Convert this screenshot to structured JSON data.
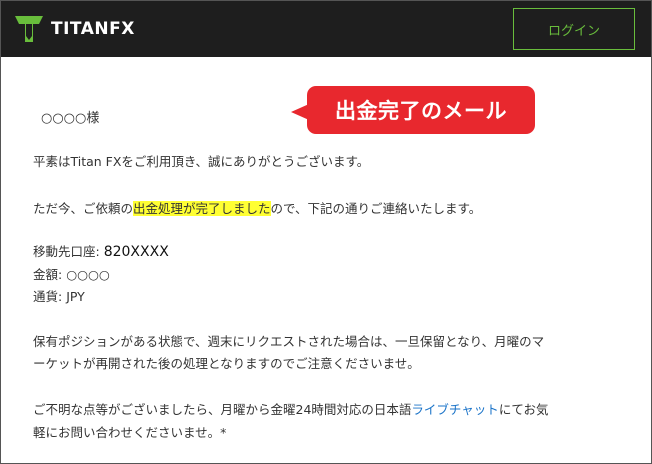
{
  "header": {
    "logo_text": "TITANFX",
    "login_label": "ログイン"
  },
  "callout": {
    "text": "出金完了のメール"
  },
  "email": {
    "salutation": "○○○○様",
    "greeting": "平素はTitan FXをご利用頂き、誠にありがとうございます。",
    "notice_prefix": "ただ今、ご依頼の",
    "notice_highlight": "出金処理が完了しました",
    "notice_suffix": "ので、下記の通りご連絡いたします。",
    "account_label": "移動先口座:",
    "account_value": "820XXXX",
    "amount_label": "金額:",
    "amount_value": "○○○○",
    "currency_label": "通貨:",
    "currency_value": "JPY",
    "weekend_line1": "保有ポジションがある状態で、週末にリクエストされた場合は、一旦保留となり、月曜のマ",
    "weekend_line2": "ーケットが再開された後の処理となりますのでご注意くださいませ。",
    "contact_prefix": "ご不明な点等がございましたら、月曜から金曜24時間対応の日本語",
    "contact_link": "ライブチャット",
    "contact_suffix": "にてお気",
    "contact_line2": "軽にお問い合わせくださいませ。*"
  },
  "colors": {
    "header_bg": "#1e1e1e",
    "brand_green": "#69bd3c",
    "callout_red": "#e8282e",
    "highlight_yellow": "#ffff33",
    "link_blue": "#1a73c8"
  },
  "icons": {
    "logo": "titanfx-shield-logo-icon"
  }
}
